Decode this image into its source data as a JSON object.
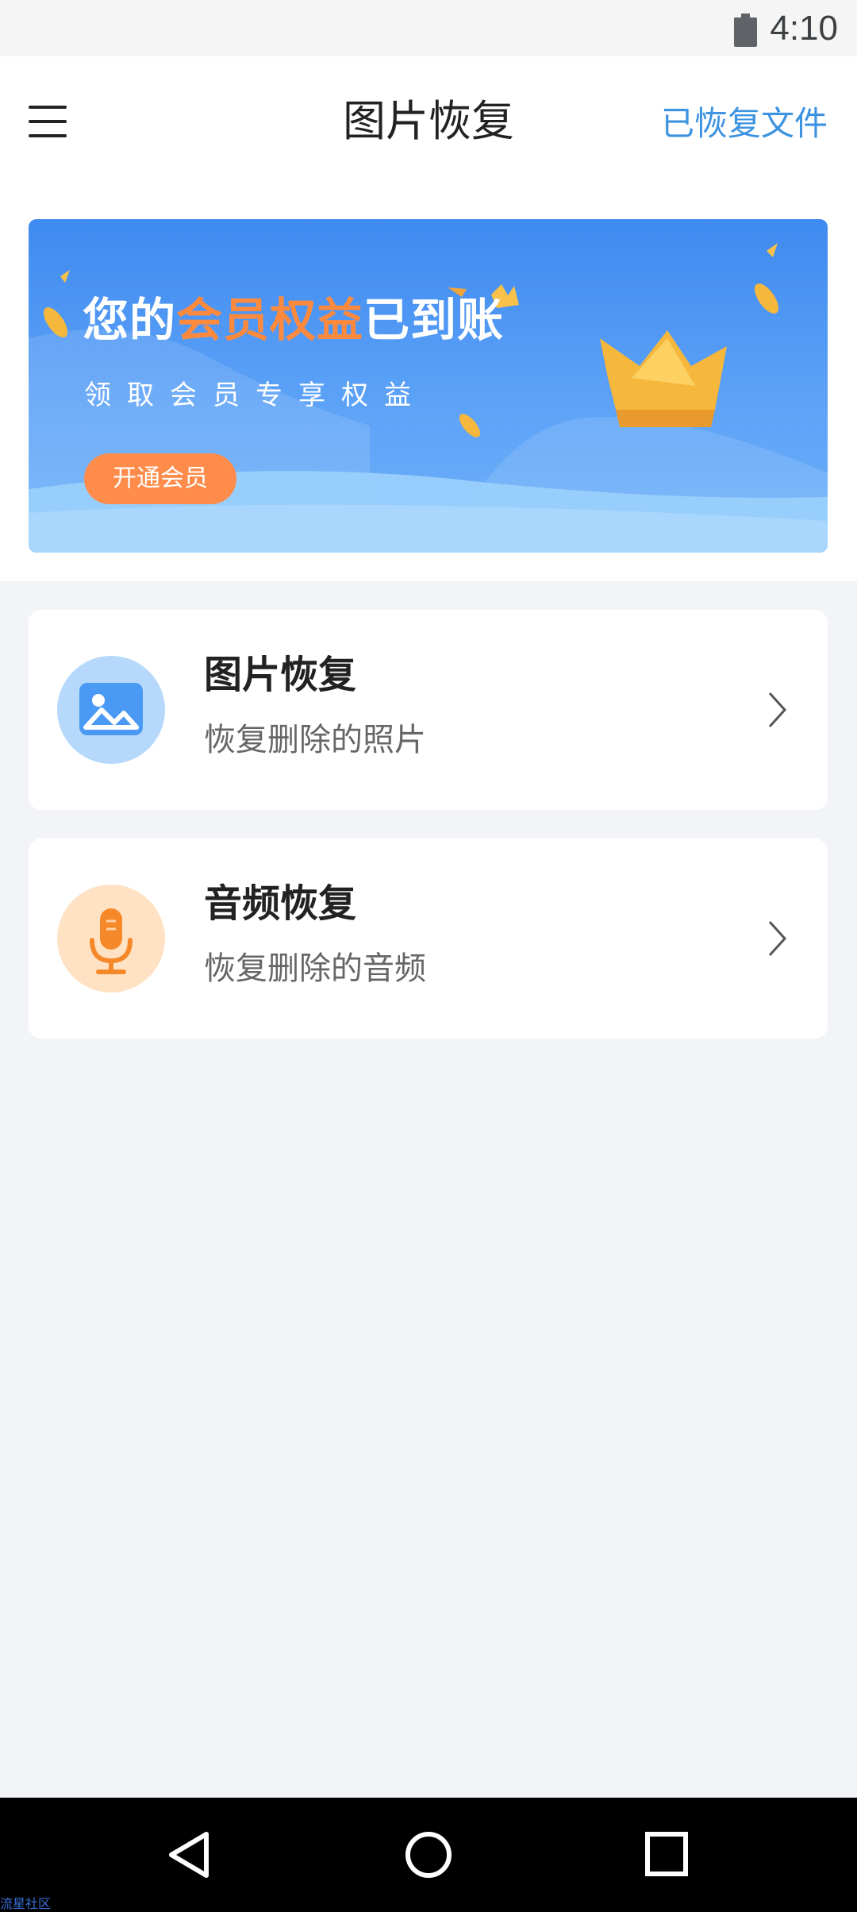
{
  "status_bar": {
    "time": "4:10",
    "battery_icon": "battery-full-icon"
  },
  "header": {
    "menu_icon": "hamburger-menu-icon",
    "title": "图片恢复",
    "recovered_files_label": "已恢复文件"
  },
  "banner": {
    "headline_part1": "您的",
    "headline_highlight": "会员权益",
    "headline_part2": "已到账",
    "subtitle": "领取会员专享权益",
    "button_label": "开通会员",
    "crown_icon": "crown-icon"
  },
  "features": [
    {
      "title": "图片恢复",
      "subtitle": "恢复删除的照片",
      "icon": "image-icon",
      "icon_color": "#4a9af5",
      "circle_color": "#b5d8fb"
    },
    {
      "title": "音频恢复",
      "subtitle": "恢复删除的音频",
      "icon": "microphone-icon",
      "icon_color": "#f5892a",
      "circle_color": "#ffe2c4"
    }
  ],
  "nav_bar": {
    "back_icon": "back-triangle-icon",
    "home_icon": "home-circle-icon",
    "recents_icon": "recents-square-icon"
  },
  "watermark": "流星社区",
  "colors": {
    "accent": "#3d93e0",
    "orange": "#ff8c4a",
    "background": "#f2f4f8"
  }
}
